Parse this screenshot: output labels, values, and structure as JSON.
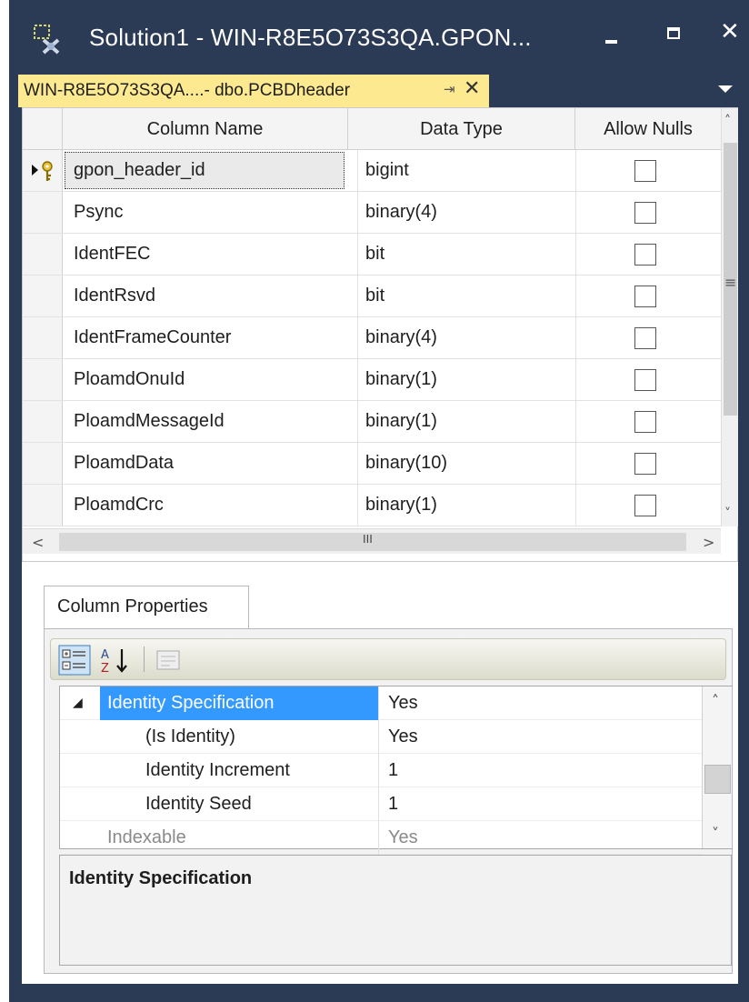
{
  "window": {
    "title": "Solution1 - WIN-R8E5O73S3QA.GPON...",
    "minimize_glyph": "—",
    "close_glyph": "✕"
  },
  "doc_tab": {
    "label": "WIN-R8E5O73S3QA....- dbo.PCBDheader",
    "pin_glyph": "⇥",
    "close_glyph": "✕"
  },
  "grid": {
    "headers": [
      "Column Name",
      "Data Type",
      "Allow Nulls"
    ],
    "rows": [
      {
        "name": "gpon_header_id",
        "type": "bigint",
        "allow_nulls": false,
        "primary_key": true
      },
      {
        "name": "Psync",
        "type": "binary(4)",
        "allow_nulls": false
      },
      {
        "name": "IdentFEC",
        "type": "bit",
        "allow_nulls": false
      },
      {
        "name": "IdentRsvd",
        "type": "bit",
        "allow_nulls": false
      },
      {
        "name": "IdentFrameCounter",
        "type": "binary(4)",
        "allow_nulls": false
      },
      {
        "name": "PloamdOnuId",
        "type": "binary(1)",
        "allow_nulls": false
      },
      {
        "name": "PloamdMessageId",
        "type": "binary(1)",
        "allow_nulls": false
      },
      {
        "name": "PloamdData",
        "type": "binary(10)",
        "allow_nulls": false
      },
      {
        "name": "PloamdCrc",
        "type": "binary(1)",
        "allow_nulls": false
      }
    ]
  },
  "scroll": {
    "up": "˄",
    "down": "˅",
    "left": "<",
    "right": ">",
    "grip": "III",
    "mid_grip": "≡"
  },
  "properties": {
    "tab_label": "Column Properties",
    "rows": [
      {
        "expander": "◢",
        "name": "Identity Specification",
        "value": "Yes",
        "selected": true,
        "indent": 0
      },
      {
        "name": "(Is Identity)",
        "value": "Yes",
        "indent": 1
      },
      {
        "name": "Identity Increment",
        "value": "1",
        "indent": 1
      },
      {
        "name": "Identity Seed",
        "value": "1",
        "indent": 1
      },
      {
        "name": "Indexable",
        "value": "Yes",
        "indent": 0,
        "dimmed": true
      }
    ],
    "description_title": "Identity Specification"
  },
  "colors": {
    "titlebar": "#2b3a55",
    "active_tab": "#fde98f",
    "selection": "#3399ff"
  },
  "icons": [
    "app-icon",
    "pin-icon",
    "close-icon",
    "primary-key-icon",
    "categorized-icon",
    "alphabetical-icon",
    "property-pages-icon",
    "expander-icon"
  ]
}
